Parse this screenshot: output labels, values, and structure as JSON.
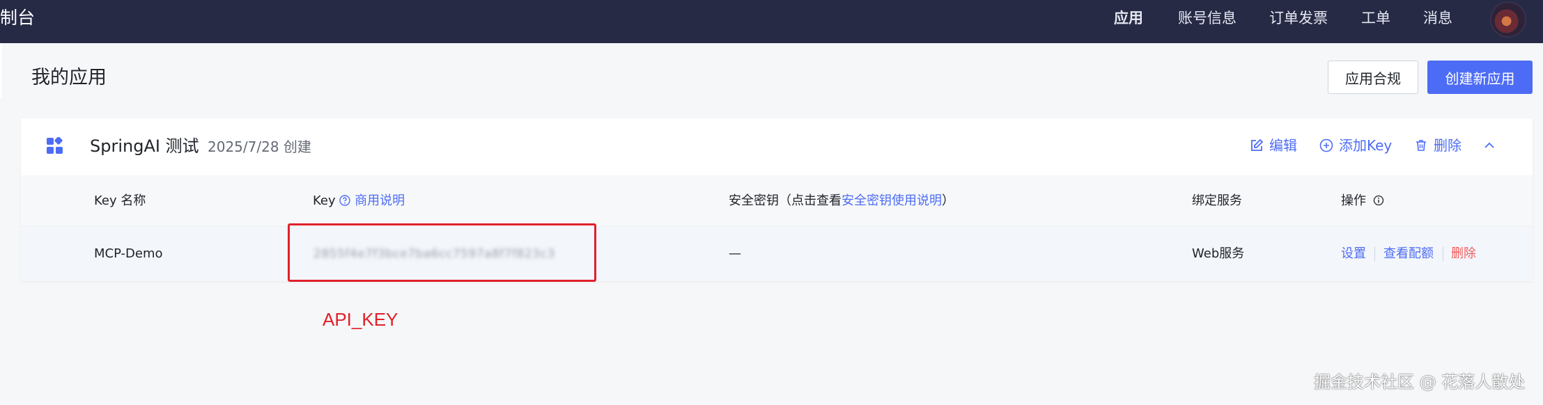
{
  "nav": {
    "brand": "制台",
    "items": [
      "应用",
      "账号信息",
      "订单发票",
      "工单",
      "消息"
    ]
  },
  "page": {
    "title": "我的应用",
    "btn_compliance": "应用合规",
    "btn_create": "创建新应用"
  },
  "app": {
    "name": "SpringAI 测试",
    "created": "2025/7/28 创建",
    "actions": {
      "edit": "编辑",
      "add_key": "添加Key",
      "delete": "删除"
    }
  },
  "table": {
    "headers": {
      "key_name": "Key 名称",
      "key": "Key",
      "key_help": "商用说明",
      "secret_prefix": "安全密钥（点击查看",
      "secret_link": "安全密钥使用说明",
      "secret_suffix": "）",
      "service": "绑定服务",
      "ops": "操作"
    },
    "rows": [
      {
        "name": "MCP-Demo",
        "key": "2855f4e7f3bce7ba6cc7597a8f7f823c3",
        "secret": "—",
        "service": "Web服务",
        "ops": {
          "settings": "设置",
          "quota": "查看配额",
          "delete": "删除"
        }
      }
    ]
  },
  "annotation": "API_KEY",
  "watermark": "掘金技术社区 @ 花落人散处",
  "colors": {
    "nav_bg": "#262a45",
    "accent": "#4d6cf5",
    "danger": "#e0202a",
    "delete_text": "#f25c5c"
  }
}
